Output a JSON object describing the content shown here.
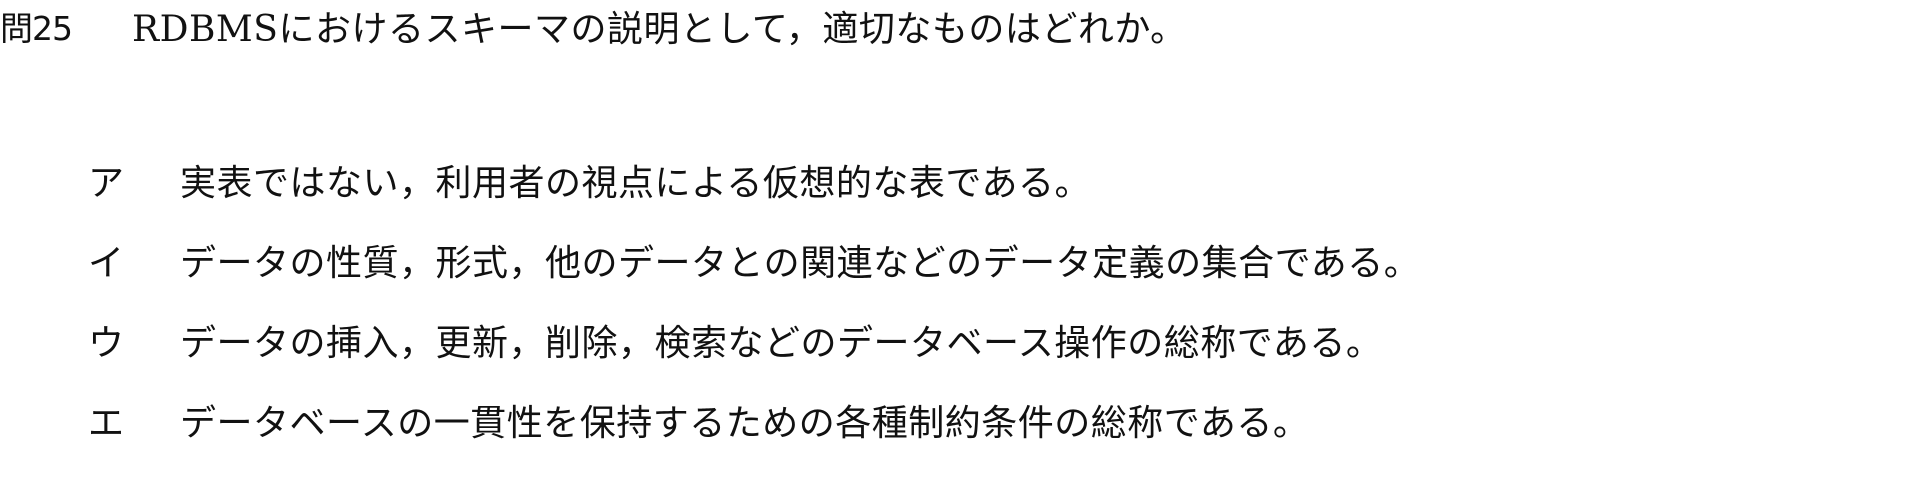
{
  "question": {
    "number": "問25",
    "text": "RDBMSにおけるスキーマの説明として，適切なものはどれか。"
  },
  "choices": [
    {
      "label": "ア",
      "text": "実表ではない，利用者の視点による仮想的な表である。"
    },
    {
      "label": "イ",
      "text": "データの性質，形式，他のデータとの関連などのデータ定義の集合である。"
    },
    {
      "label": "ウ",
      "text": "データの挿入，更新，削除，検索などのデータベース操作の総称である。"
    },
    {
      "label": "エ",
      "text": "データベースの一貫性を保持するための各種制約条件の総称である。"
    }
  ]
}
